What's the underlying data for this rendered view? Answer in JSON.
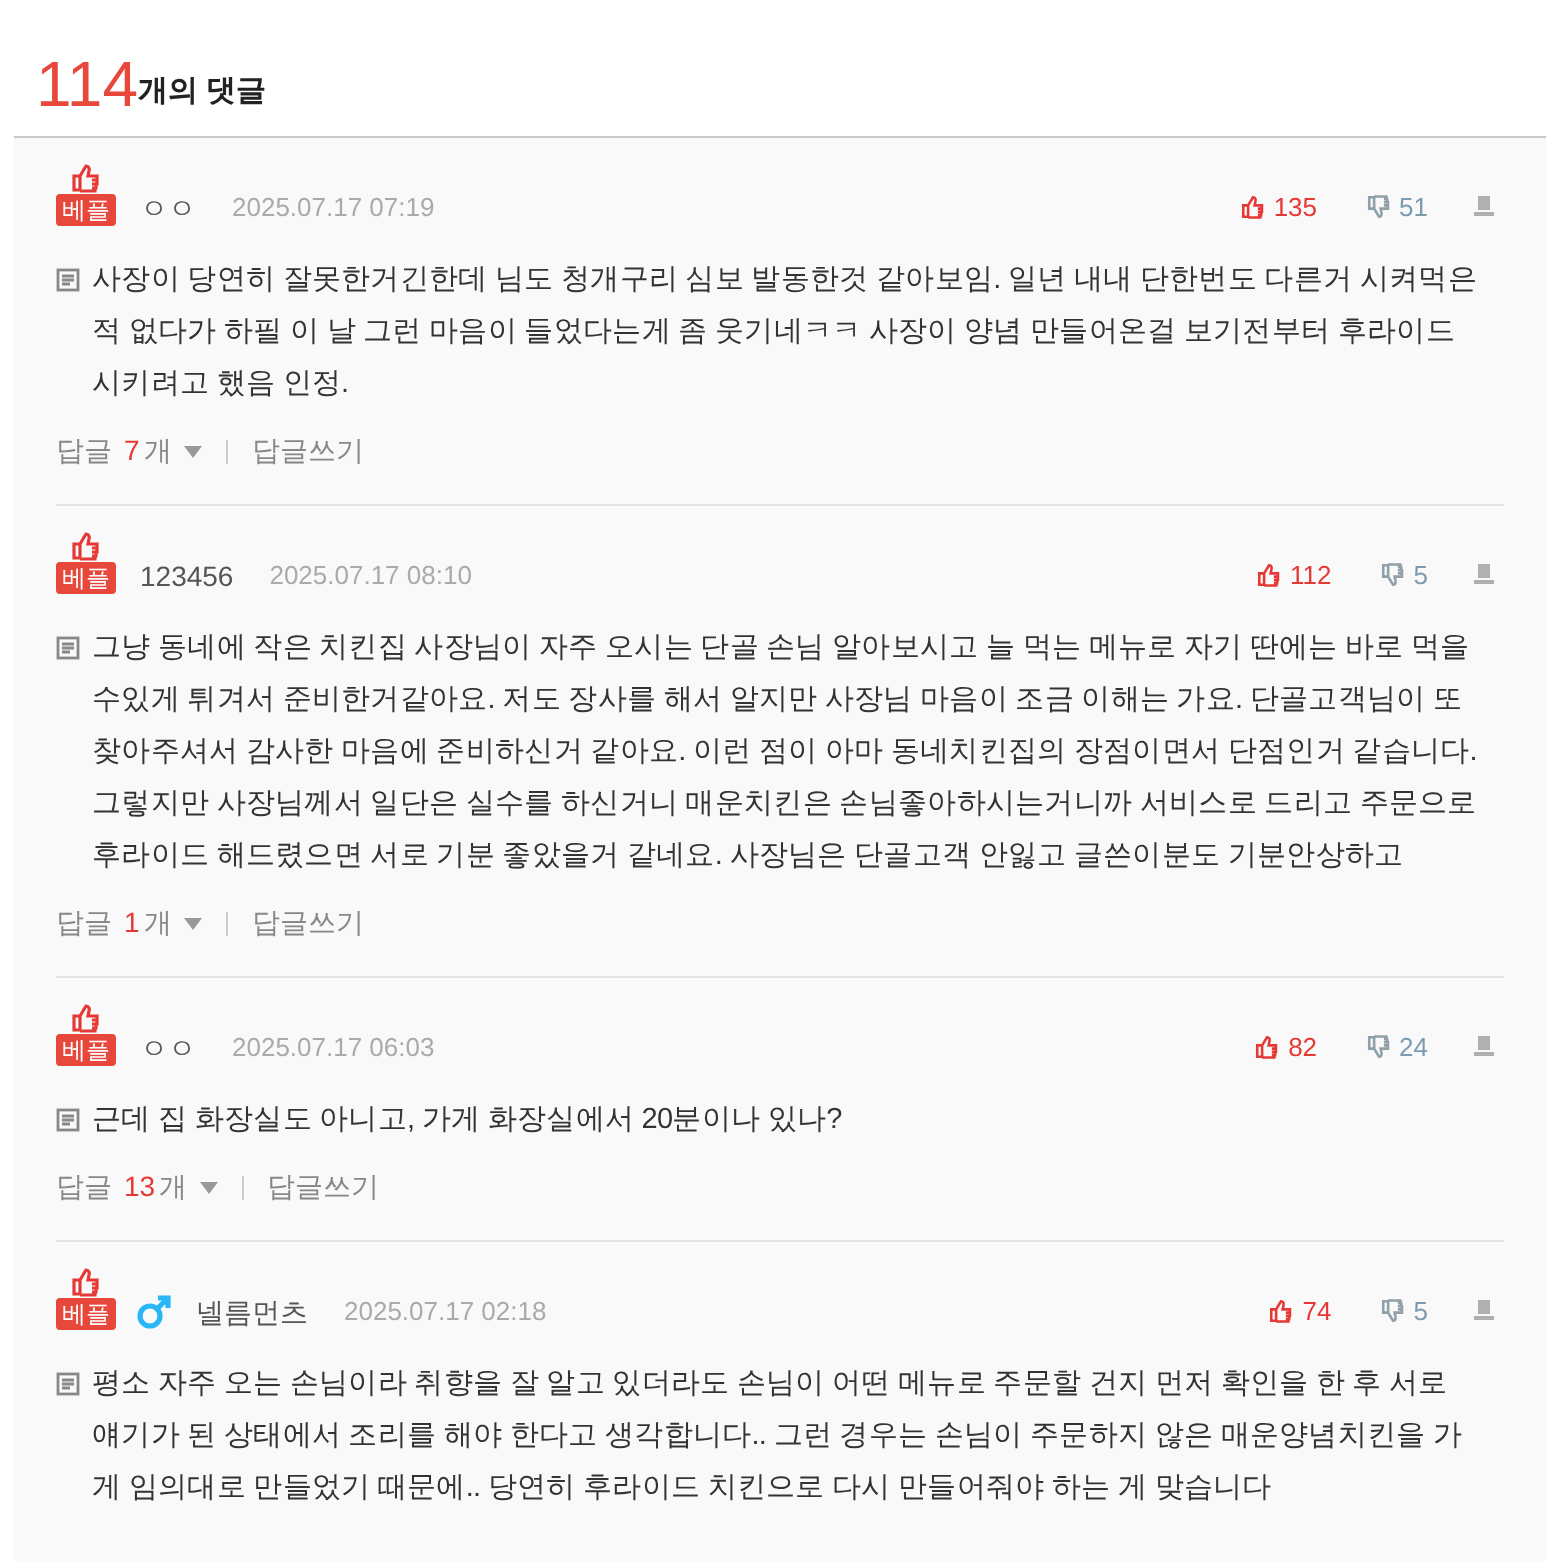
{
  "header": {
    "count": "114",
    "label": "개의 댓글"
  },
  "comments": [
    {
      "badge": "베플",
      "author": "ㅇㅇ",
      "date": "2025.07.17 07:19",
      "likes": "135",
      "dislikes": "51",
      "body": "사장이 당연히 잘못한거긴한데 님도 청개구리 심보 발동한것 같아보임. 일년 내내 단한번도 다른거 시켜먹은적 없다가 하필 이 날 그런 마음이 들었다는게 좀 웃기네ㅋㅋ 사장이 양념 만들어온걸 보기전부터 후라이드 시키려고 했음 인정.",
      "reply_label": "답글",
      "reply_count": "7",
      "reply_unit": "개",
      "write_reply": "답글쓰기"
    },
    {
      "badge": "베플",
      "author": "123456",
      "date": "2025.07.17 08:10",
      "likes": "112",
      "dislikes": "5",
      "body": "그냥 동네에 작은 치킨집 사장님이 자주 오시는 단골 손님 알아보시고 늘 먹는 메뉴로 자기 딴에는 바로 먹을 수있게 튀겨서 준비한거같아요. 저도 장사를 해서 알지만 사장님 마음이 조금 이해는 가요. 단골고객님이 또 찾아주셔서 감사한 마음에 준비하신거 같아요. 이런 점이 아마 동네치킨집의 장점이면서 단점인거 같습니다. 그렇지만 사장님께서 일단은 실수를 하신거니 매운치킨은 손님좋아하시는거니까 서비스로 드리고 주문으로 후라이드 해드렸으면 서로 기분 좋았을거 같네요. 사장님은 단골고객 안잃고 글쓴이분도 기분안상하고",
      "reply_label": "답글",
      "reply_count": "1",
      "reply_unit": "개",
      "write_reply": "답글쓰기"
    },
    {
      "badge": "베플",
      "author": "ㅇㅇ",
      "date": "2025.07.17 06:03",
      "likes": "82",
      "dislikes": "24",
      "body": "근데 집 화장실도 아니고, 가게 화장실에서 20분이나 있나?",
      "reply_label": "답글",
      "reply_count": "13",
      "reply_unit": "개",
      "write_reply": "답글쓰기"
    },
    {
      "badge": "베플",
      "male": true,
      "author": "넬름먼츠",
      "date": "2025.07.17 02:18",
      "likes": "74",
      "dislikes": "5",
      "body": "평소 자주 오는 손님이라 취향을 잘 알고 있더라도 손님이 어떤 메뉴로 주문할 건지 먼저 확인을 한 후 서로 얘기가 된 상태에서 조리를 해야 한다고 생각합니다.. 그런 경우는 손님이 주문하지 않은 매운양념치킨을 가게 임의대로 만들었기 때문에.. 당연히 후라이드 치킨으로 다시 만들어줘야 하는 게 맞습니다"
    }
  ]
}
